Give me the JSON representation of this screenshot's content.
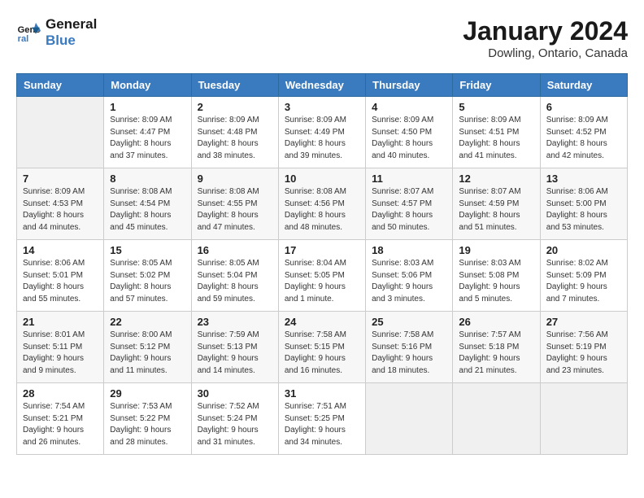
{
  "header": {
    "logo_line1": "General",
    "logo_line2": "Blue",
    "title": "January 2024",
    "subtitle": "Dowling, Ontario, Canada"
  },
  "days_of_week": [
    "Sunday",
    "Monday",
    "Tuesday",
    "Wednesday",
    "Thursday",
    "Friday",
    "Saturday"
  ],
  "weeks": [
    [
      {
        "day": "",
        "info": ""
      },
      {
        "day": "1",
        "info": "Sunrise: 8:09 AM\nSunset: 4:47 PM\nDaylight: 8 hours\nand 37 minutes."
      },
      {
        "day": "2",
        "info": "Sunrise: 8:09 AM\nSunset: 4:48 PM\nDaylight: 8 hours\nand 38 minutes."
      },
      {
        "day": "3",
        "info": "Sunrise: 8:09 AM\nSunset: 4:49 PM\nDaylight: 8 hours\nand 39 minutes."
      },
      {
        "day": "4",
        "info": "Sunrise: 8:09 AM\nSunset: 4:50 PM\nDaylight: 8 hours\nand 40 minutes."
      },
      {
        "day": "5",
        "info": "Sunrise: 8:09 AM\nSunset: 4:51 PM\nDaylight: 8 hours\nand 41 minutes."
      },
      {
        "day": "6",
        "info": "Sunrise: 8:09 AM\nSunset: 4:52 PM\nDaylight: 8 hours\nand 42 minutes."
      }
    ],
    [
      {
        "day": "7",
        "info": "Sunrise: 8:09 AM\nSunset: 4:53 PM\nDaylight: 8 hours\nand 44 minutes."
      },
      {
        "day": "8",
        "info": "Sunrise: 8:08 AM\nSunset: 4:54 PM\nDaylight: 8 hours\nand 45 minutes."
      },
      {
        "day": "9",
        "info": "Sunrise: 8:08 AM\nSunset: 4:55 PM\nDaylight: 8 hours\nand 47 minutes."
      },
      {
        "day": "10",
        "info": "Sunrise: 8:08 AM\nSunset: 4:56 PM\nDaylight: 8 hours\nand 48 minutes."
      },
      {
        "day": "11",
        "info": "Sunrise: 8:07 AM\nSunset: 4:57 PM\nDaylight: 8 hours\nand 50 minutes."
      },
      {
        "day": "12",
        "info": "Sunrise: 8:07 AM\nSunset: 4:59 PM\nDaylight: 8 hours\nand 51 minutes."
      },
      {
        "day": "13",
        "info": "Sunrise: 8:06 AM\nSunset: 5:00 PM\nDaylight: 8 hours\nand 53 minutes."
      }
    ],
    [
      {
        "day": "14",
        "info": "Sunrise: 8:06 AM\nSunset: 5:01 PM\nDaylight: 8 hours\nand 55 minutes."
      },
      {
        "day": "15",
        "info": "Sunrise: 8:05 AM\nSunset: 5:02 PM\nDaylight: 8 hours\nand 57 minutes."
      },
      {
        "day": "16",
        "info": "Sunrise: 8:05 AM\nSunset: 5:04 PM\nDaylight: 8 hours\nand 59 minutes."
      },
      {
        "day": "17",
        "info": "Sunrise: 8:04 AM\nSunset: 5:05 PM\nDaylight: 9 hours\nand 1 minute."
      },
      {
        "day": "18",
        "info": "Sunrise: 8:03 AM\nSunset: 5:06 PM\nDaylight: 9 hours\nand 3 minutes."
      },
      {
        "day": "19",
        "info": "Sunrise: 8:03 AM\nSunset: 5:08 PM\nDaylight: 9 hours\nand 5 minutes."
      },
      {
        "day": "20",
        "info": "Sunrise: 8:02 AM\nSunset: 5:09 PM\nDaylight: 9 hours\nand 7 minutes."
      }
    ],
    [
      {
        "day": "21",
        "info": "Sunrise: 8:01 AM\nSunset: 5:11 PM\nDaylight: 9 hours\nand 9 minutes."
      },
      {
        "day": "22",
        "info": "Sunrise: 8:00 AM\nSunset: 5:12 PM\nDaylight: 9 hours\nand 11 minutes."
      },
      {
        "day": "23",
        "info": "Sunrise: 7:59 AM\nSunset: 5:13 PM\nDaylight: 9 hours\nand 14 minutes."
      },
      {
        "day": "24",
        "info": "Sunrise: 7:58 AM\nSunset: 5:15 PM\nDaylight: 9 hours\nand 16 minutes."
      },
      {
        "day": "25",
        "info": "Sunrise: 7:58 AM\nSunset: 5:16 PM\nDaylight: 9 hours\nand 18 minutes."
      },
      {
        "day": "26",
        "info": "Sunrise: 7:57 AM\nSunset: 5:18 PM\nDaylight: 9 hours\nand 21 minutes."
      },
      {
        "day": "27",
        "info": "Sunrise: 7:56 AM\nSunset: 5:19 PM\nDaylight: 9 hours\nand 23 minutes."
      }
    ],
    [
      {
        "day": "28",
        "info": "Sunrise: 7:54 AM\nSunset: 5:21 PM\nDaylight: 9 hours\nand 26 minutes."
      },
      {
        "day": "29",
        "info": "Sunrise: 7:53 AM\nSunset: 5:22 PM\nDaylight: 9 hours\nand 28 minutes."
      },
      {
        "day": "30",
        "info": "Sunrise: 7:52 AM\nSunset: 5:24 PM\nDaylight: 9 hours\nand 31 minutes."
      },
      {
        "day": "31",
        "info": "Sunrise: 7:51 AM\nSunset: 5:25 PM\nDaylight: 9 hours\nand 34 minutes."
      },
      {
        "day": "",
        "info": ""
      },
      {
        "day": "",
        "info": ""
      },
      {
        "day": "",
        "info": ""
      }
    ]
  ]
}
